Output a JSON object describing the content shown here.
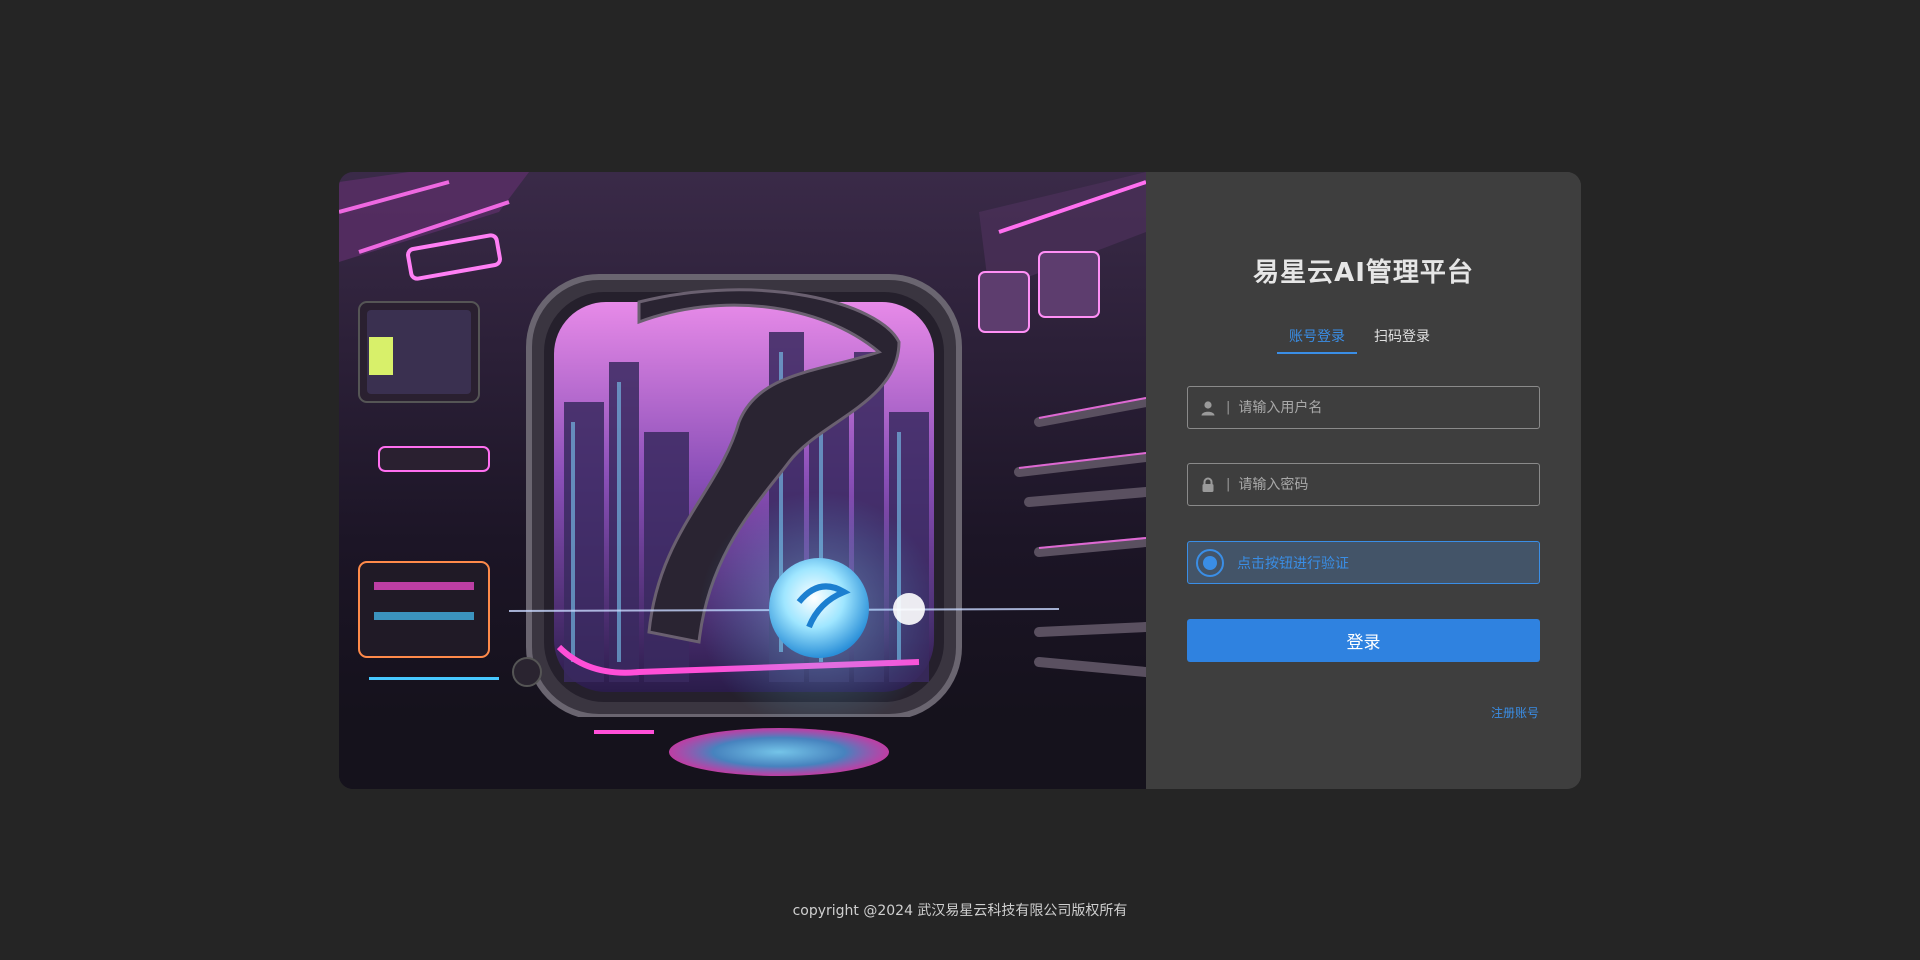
{
  "login": {
    "title": "易星云AI管理平台",
    "tabs": [
      {
        "label": "账号登录",
        "active": true
      },
      {
        "label": "扫码登录",
        "active": false
      }
    ],
    "username": {
      "placeholder": "请输入用户名",
      "value": "",
      "icon": "user-icon"
    },
    "password": {
      "placeholder": "请输入密码",
      "value": "",
      "icon": "lock-icon"
    },
    "verify_label": "点击按钮进行验证",
    "submit_label": "登录",
    "register_label": "注册账号",
    "separator": "|"
  },
  "footer": {
    "copyright": "copyright @2024 武汉易星云科技有限公司版权所有"
  },
  "colors": {
    "background": "#252525",
    "panel": "#3e3e3e",
    "accent": "#2f82e0",
    "hero_pink": "#ff4fd8",
    "hero_cyan": "#47c8ff"
  }
}
